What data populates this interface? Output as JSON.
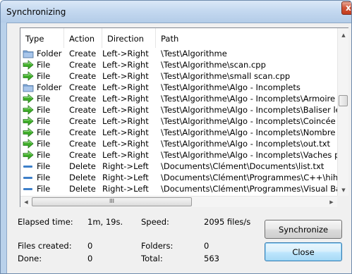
{
  "window": {
    "title": "Synchronizing",
    "close_glyph": "x"
  },
  "list": {
    "columns": [
      {
        "label": "Type"
      },
      {
        "label": "Action"
      },
      {
        "label": "Direction"
      },
      {
        "label": "Path"
      }
    ],
    "rows": [
      {
        "icon": "folder-icon",
        "type": "Folder",
        "action": "Create",
        "direction": "Left->Right",
        "path": "\\Test\\Algorithme"
      },
      {
        "icon": "green-arrow-icon",
        "type": "File",
        "action": "Create",
        "direction": "Left->Right",
        "path": "\\Test\\Algorithme\\scan.cpp"
      },
      {
        "icon": "green-arrow-icon",
        "type": "File",
        "action": "Create",
        "direction": "Left->Right",
        "path": "\\Test\\Algorithme\\small scan.cpp"
      },
      {
        "icon": "folder-icon",
        "type": "Folder",
        "action": "Create",
        "direction": "Left->Right",
        "path": "\\Test\\Algorithme\\Algo - Incomplets"
      },
      {
        "icon": "green-arrow-icon",
        "type": "File",
        "action": "Create",
        "direction": "Left->Right",
        "path": "\\Test\\Algorithme\\Algo - Incomplets\\Armoire d"
      },
      {
        "icon": "green-arrow-icon",
        "type": "File",
        "action": "Create",
        "direction": "Left->Right",
        "path": "\\Test\\Algorithme\\Algo - Incomplets\\Baliser le"
      },
      {
        "icon": "green-arrow-icon",
        "type": "File",
        "action": "Create",
        "direction": "Left->Right",
        "path": "\\Test\\Algorithme\\Algo - Incomplets\\Coincée d"
      },
      {
        "icon": "green-arrow-icon",
        "type": "File",
        "action": "Create",
        "direction": "Left->Right",
        "path": "\\Test\\Algorithme\\Algo - Incomplets\\Nombre d"
      },
      {
        "icon": "green-arrow-icon",
        "type": "File",
        "action": "Create",
        "direction": "Left->Right",
        "path": "\\Test\\Algorithme\\Algo - Incomplets\\out.txt"
      },
      {
        "icon": "green-arrow-icon",
        "type": "File",
        "action": "Create",
        "direction": "Left->Right",
        "path": "\\Test\\Algorithme\\Algo - Incomplets\\Vaches pl"
      },
      {
        "icon": "delete-dash-icon",
        "type": "File",
        "action": "Delete",
        "direction": "Right->Left",
        "path": "\\Documents\\Clément\\Documents\\list.txt"
      },
      {
        "icon": "delete-dash-icon",
        "type": "File",
        "action": "Delete",
        "direction": "Right->Left",
        "path": "\\Documents\\Clément\\Programmes\\C++\\hih.e"
      },
      {
        "icon": "delete-dash-icon",
        "type": "File",
        "action": "Delete",
        "direction": "Right->Left",
        "path": "\\Documents\\Clément\\Programmes\\Visual Bas"
      }
    ],
    "hscroll_grip": "III"
  },
  "stats": {
    "elapsed_label": "Elapsed time:",
    "elapsed_value": "1m, 19s.",
    "speed_label": "Speed:",
    "speed_value": "2095 files/s",
    "files_created_label": "Files created:",
    "files_created_value": "0",
    "folders_label": "Folders:",
    "folders_value": "0",
    "done_label": "Done:",
    "done_value": "0",
    "total_label": "Total:",
    "total_value": "563"
  },
  "buttons": {
    "synchronize": "Synchronize",
    "close": "Close"
  },
  "colors": {
    "folder": "#7fa7d6",
    "arrow": "#3fae29",
    "delete": "#3d7fc9"
  }
}
